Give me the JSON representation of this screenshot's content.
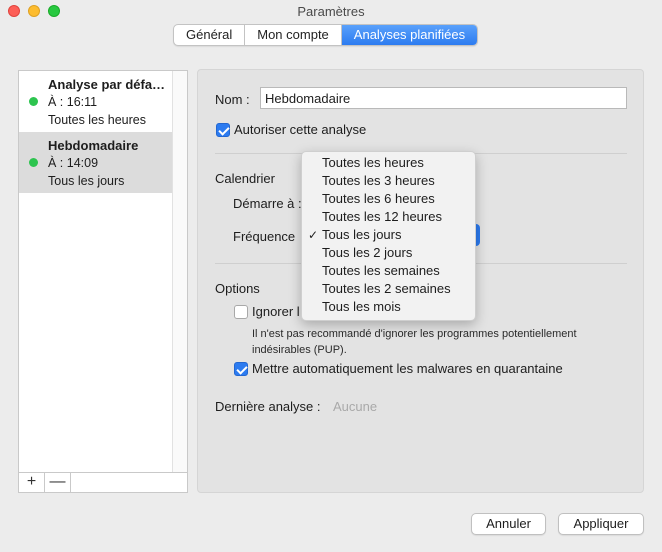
{
  "window": {
    "title": "Paramètres"
  },
  "tabs": [
    {
      "label": "Général",
      "active": false
    },
    {
      "label": "Mon compte",
      "active": false
    },
    {
      "label": "Analyses planifiées",
      "active": true
    }
  ],
  "scans": [
    {
      "name": "Analyse par défa…",
      "time": "À : 16:11",
      "frequency": "Toutes les heures",
      "status_color": "#2dc44f",
      "selected": false
    },
    {
      "name": "Hebdomadaire",
      "time": "À : 14:09",
      "frequency": "Tous les jours",
      "status_color": "#2dc44f",
      "selected": true
    }
  ],
  "list_footer": {
    "add": "+",
    "remove": "—"
  },
  "detail": {
    "name_label": "Nom :",
    "name_value": "Hebdomadaire",
    "allow_label": "Autoriser cette analyse",
    "allow_checked": true,
    "calendar_label": "Calendrier",
    "starts_label": "Démarre à :",
    "frequency_label": "Fréquence",
    "options_label": "Options",
    "ignore_label": "Ignorer l",
    "ignore_checked": false,
    "pup_note_line1": "Il n'est pas recommandé d'ignorer les programmes potentiellement",
    "pup_note_line2": "indésirables (PUP).",
    "quarantine_label": "Mettre automatiquement les malwares en quarantaine",
    "quarantine_checked": true,
    "last_scan_label": "Dernière analyse :",
    "last_scan_value": "Aucune"
  },
  "frequency_menu": {
    "selected_index": 4,
    "check_glyph": "✓",
    "options": [
      "Toutes les heures",
      "Toutes les 3 heures",
      "Toutes les 6 heures",
      "Toutes les 12 heures",
      "Tous les jours",
      "Tous les 2 jours",
      "Toutes les semaines",
      "Toutes les 2 semaines",
      "Tous les mois"
    ]
  },
  "buttons": {
    "cancel": "Annuler",
    "apply": "Appliquer"
  },
  "colors": {
    "accent": "#2c7bf0",
    "status_green": "#2dc44f"
  }
}
